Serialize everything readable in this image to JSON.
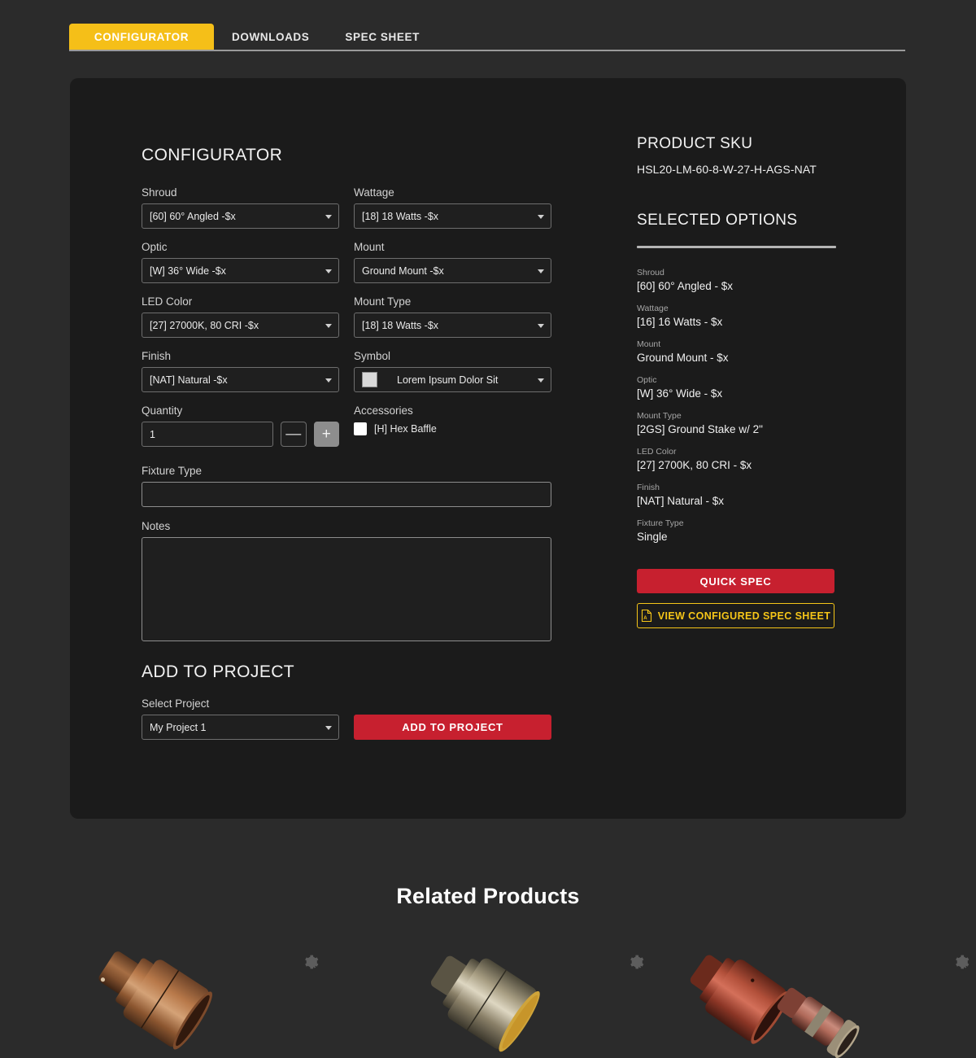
{
  "tabs": [
    {
      "label": "CONFIGURATOR",
      "active": true
    },
    {
      "label": "DOWNLOADS",
      "active": false
    },
    {
      "label": "SPEC SHEET",
      "active": false
    }
  ],
  "configurator": {
    "title": "CONFIGURATOR",
    "fields": {
      "shroud": {
        "label": "Shroud",
        "value": "[60] 60° Angled -$x"
      },
      "wattage": {
        "label": "Wattage",
        "value": "[18] 18 Watts -$x"
      },
      "optic": {
        "label": "Optic",
        "value": "[W] 36°  Wide -$x"
      },
      "mount": {
        "label": "Mount",
        "value": "Ground Mount -$x"
      },
      "led_color": {
        "label": "LED Color",
        "value": "[27] 27000K, 80 CRI -$x"
      },
      "mount_type": {
        "label": "Mount Type",
        "value": "[18] 18 Watts -$x"
      },
      "finish": {
        "label": "Finish",
        "value": "[NAT] Natural -$x"
      },
      "symbol": {
        "label": "Symbol",
        "value": "Lorem Ipsum Dolor Sit",
        "swatch_color": "#d9d9d9"
      },
      "quantity": {
        "label": "Quantity",
        "value": "1",
        "decrement_label": "—",
        "increment_label": "+"
      },
      "accessories": {
        "label": "Accessories",
        "option_label": "[H] Hex Baffle",
        "checked": false
      },
      "fixture_type": {
        "label": "Fixture Type",
        "value": "",
        "placeholder": ""
      },
      "notes": {
        "label": "Notes",
        "value": "",
        "placeholder": ""
      }
    }
  },
  "add_to_project": {
    "title": "ADD TO PROJECT",
    "select_label": "Select Project",
    "selected_project": "My Project 1",
    "button_label": "ADD TO PROJECT"
  },
  "sidebar": {
    "sku_heading": "PRODUCT SKU",
    "sku_value": "HSL20-LM-60-8-W-27-H-AGS-NAT",
    "options_heading": "SELECTED OPTIONS",
    "options": [
      {
        "label": "Shroud",
        "value": "[60] 60° Angled - $x"
      },
      {
        "label": "Wattage",
        "value": "[16] 16 Watts - $x"
      },
      {
        "label": "Mount",
        "value": "Ground Mount - $x"
      },
      {
        "label": "Optic",
        "value": "[W] 36° Wide - $x"
      },
      {
        "label": "Mount Type",
        "value": "[2GS] Ground Stake w/ 2\""
      },
      {
        "label": "LED Color",
        "value": "[27] 2700K, 80 CRI - $x"
      },
      {
        "label": "Finish",
        "value": "[NAT] Natural - $x"
      },
      {
        "label": "Fixture Type",
        "value": "Single"
      }
    ],
    "quick_spec_label": "QUICK SPEC",
    "spec_sheet_label": "VIEW CONFIGURED SPEC SHEET"
  },
  "related": {
    "title": "Related Products",
    "items": [
      {
        "finish": "copper"
      },
      {
        "finish": "brass"
      },
      {
        "finish": "red-copper"
      }
    ]
  },
  "colors": {
    "accent_yellow": "#f5bf18",
    "accent_red": "#c7202f",
    "page_bg": "#2b2b2b",
    "panel_bg": "#1b1b1b"
  }
}
